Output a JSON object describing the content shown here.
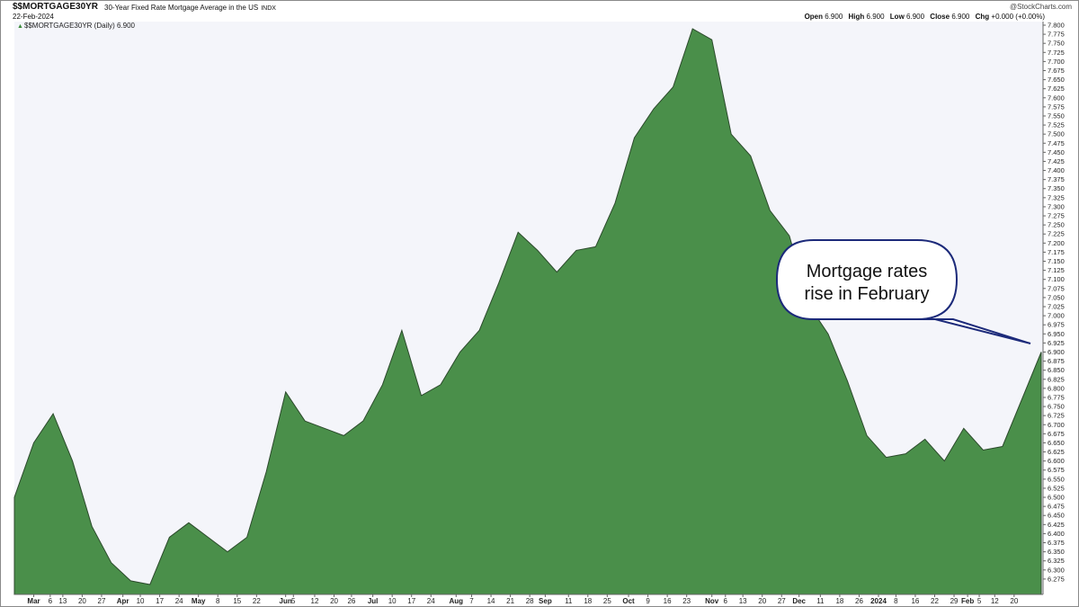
{
  "header": {
    "symbol": "$$MORTGAGE30YR",
    "title": "30-Year Fixed Rate Mortgage Average in the US",
    "exchange": "INDX",
    "date": "22-Feb-2024",
    "credit": "@StockCharts.com",
    "ohlc": {
      "open_label": "Open",
      "open": "6.900",
      "high_label": "High",
      "high": "6.900",
      "low_label": "Low",
      "low": "6.900",
      "close_label": "Close",
      "close": "6.900",
      "chg_label": "Chg",
      "chg": "+0.000 (+0.00%)"
    }
  },
  "legend": {
    "label": "$$MORTGAGE30YR (Daily) 6.900",
    "marker": "▲"
  },
  "callout": {
    "line1": "Mortgage rates",
    "line2": "rise in February"
  },
  "colors": {
    "area_fill": "#4a8f4a",
    "area_stroke": "#2c4a2c",
    "plot_background": "#f4f5fa",
    "callout_border": "#1c2a7a"
  },
  "chart_data": {
    "type": "area",
    "title": "30-Year Fixed Rate Mortgage Average in the US",
    "series": [
      {
        "values": [
          6.5,
          6.65,
          6.73,
          6.6,
          6.42,
          6.32,
          6.27,
          6.26,
          6.39,
          6.43,
          6.39,
          6.35,
          6.39,
          6.57,
          6.79,
          6.71,
          6.69,
          6.67,
          6.71,
          6.81,
          6.96,
          6.78,
          6.81,
          6.9,
          6.96,
          7.09,
          7.23,
          7.18,
          7.12,
          7.18,
          7.19,
          7.31,
          7.49,
          7.57,
          7.63,
          7.79,
          7.76,
          7.5,
          7.44,
          7.29,
          7.22,
          7.03,
          6.95,
          6.82,
          6.67,
          6.61,
          6.62,
          6.66,
          6.6,
          6.69,
          6.63,
          6.64,
          6.77,
          6.9
        ]
      }
    ],
    "ylim": [
      6.25,
      7.8
    ],
    "y_ticks": [
      "7.800",
      "7.775",
      "7.750",
      "7.725",
      "7.700",
      "7.675",
      "7.650",
      "7.625",
      "7.600",
      "7.575",
      "7.550",
      "7.525",
      "7.500",
      "7.475",
      "7.450",
      "7.425",
      "7.400",
      "7.375",
      "7.350",
      "7.325",
      "7.300",
      "7.275",
      "7.250",
      "7.225",
      "7.200",
      "7.175",
      "7.150",
      "7.125",
      "7.100",
      "7.075",
      "7.050",
      "7.025",
      "7.000",
      "6.975",
      "6.950",
      "6.925",
      "6.900",
      "6.875",
      "6.850",
      "6.825",
      "6.800",
      "6.775",
      "6.750",
      "6.725",
      "6.700",
      "6.675",
      "6.650",
      "6.625",
      "6.600",
      "6.575",
      "6.550",
      "6.525",
      "6.500",
      "6.475",
      "6.450",
      "6.425",
      "6.400",
      "6.375",
      "6.350",
      "6.325",
      "6.300",
      "6.275"
    ],
    "x_ticks": [
      {
        "label": "Mar",
        "bold": true,
        "i": 1
      },
      {
        "label": "6",
        "i": 1.85
      },
      {
        "label": "13",
        "i": 2.5
      },
      {
        "label": "20",
        "i": 3.5
      },
      {
        "label": "27",
        "i": 4.5
      },
      {
        "label": "Apr",
        "bold": true,
        "i": 5.6
      },
      {
        "label": "10",
        "i": 6.5
      },
      {
        "label": "17",
        "i": 7.5
      },
      {
        "label": "24",
        "i": 8.5
      },
      {
        "label": "May",
        "bold": true,
        "i": 9.5
      },
      {
        "label": "8",
        "i": 10.5
      },
      {
        "label": "15",
        "i": 11.5
      },
      {
        "label": "22",
        "i": 12.5
      },
      {
        "label": "Jun",
        "bold": true,
        "i": 14.0
      },
      {
        "label": "5",
        "i": 14.4
      },
      {
        "label": "12",
        "i": 15.5
      },
      {
        "label": "20",
        "i": 16.5
      },
      {
        "label": "26",
        "i": 17.4
      },
      {
        "label": "Jul",
        "bold": true,
        "i": 18.5
      },
      {
        "label": "10",
        "i": 19.5
      },
      {
        "label": "17",
        "i": 20.5
      },
      {
        "label": "24",
        "i": 21.5
      },
      {
        "label": "Aug",
        "bold": true,
        "i": 22.8
      },
      {
        "label": "7",
        "i": 23.6
      },
      {
        "label": "14",
        "i": 24.6
      },
      {
        "label": "21",
        "i": 25.6
      },
      {
        "label": "28",
        "i": 26.6
      },
      {
        "label": "Sep",
        "bold": true,
        "i": 27.4
      },
      {
        "label": "11",
        "i": 28.6
      },
      {
        "label": "18",
        "i": 29.6
      },
      {
        "label": "25",
        "i": 30.6
      },
      {
        "label": "Oct",
        "bold": true,
        "i": 31.7
      },
      {
        "label": "9",
        "i": 32.7
      },
      {
        "label": "16",
        "i": 33.7
      },
      {
        "label": "23",
        "i": 34.7
      },
      {
        "label": "Nov",
        "bold": true,
        "i": 36.0
      },
      {
        "label": "6",
        "i": 36.7
      },
      {
        "label": "13",
        "i": 37.6
      },
      {
        "label": "20",
        "i": 38.6
      },
      {
        "label": "27",
        "i": 39.6
      },
      {
        "label": "Dec",
        "bold": true,
        "i": 40.5
      },
      {
        "label": "11",
        "i": 41.6
      },
      {
        "label": "18",
        "i": 42.6
      },
      {
        "label": "26",
        "i": 43.6
      },
      {
        "label": "2024",
        "bold": true,
        "i": 44.6
      },
      {
        "label": "8",
        "i": 45.5
      },
      {
        "label": "16",
        "i": 46.5
      },
      {
        "label": "22",
        "i": 47.5
      },
      {
        "label": "29",
        "i": 48.5
      },
      {
        "label": "Feb",
        "bold": true,
        "i": 49.2
      },
      {
        "label": "5",
        "i": 49.8
      },
      {
        "label": "12",
        "i": 50.6
      },
      {
        "label": "20",
        "i": 51.6
      }
    ],
    "grid": false,
    "legend": "top-left"
  }
}
